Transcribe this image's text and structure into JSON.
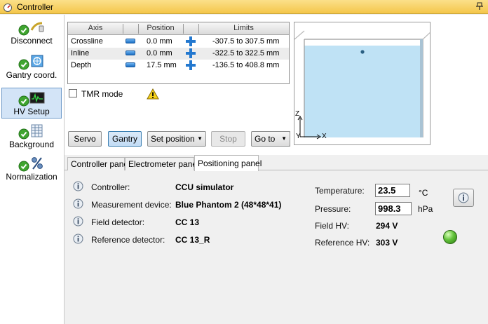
{
  "window": {
    "title": "Controller"
  },
  "sidebar": {
    "items": [
      {
        "label": "Disconnect",
        "icon": "disconnect-plug-icon"
      },
      {
        "label": "Gantry coord.",
        "icon": "gantry-coordinates-icon"
      },
      {
        "label": "HV Setup",
        "icon": "hv-oscilloscope-icon",
        "active": true
      },
      {
        "label": "Background",
        "icon": "background-grid-icon"
      },
      {
        "label": "Normalization",
        "icon": "percent-icon"
      }
    ]
  },
  "axis_table": {
    "headers": [
      "Axis",
      "Position",
      "Limits"
    ],
    "rows": [
      {
        "axis": "Crossline",
        "position": "0.0 mm",
        "limits": "-307.5 to 307.5 mm"
      },
      {
        "axis": "Inline",
        "position": "0.0 mm",
        "limits": "-322.5 to 322.5 mm"
      },
      {
        "axis": "Depth",
        "position": "17.5 mm",
        "limits": "-136.5 to 408.8 mm"
      }
    ]
  },
  "tmr": {
    "label": "TMR mode",
    "checked": false
  },
  "buttons": {
    "servo": "Servo",
    "gantry": "Gantry",
    "set_position": "Set position",
    "stop": "Stop",
    "go_to": "Go to"
  },
  "phantom_view": {
    "axes": {
      "z": "Z",
      "y": "Y",
      "x": "X"
    },
    "water_color": "#bfe2f5"
  },
  "tabs": [
    {
      "label": "Controller panel",
      "active": false
    },
    {
      "label": "Electrometer panel",
      "active": false
    },
    {
      "label": "Positioning panel",
      "active": true
    }
  ],
  "panel": {
    "info": [
      {
        "label": "Controller:",
        "value": "CCU simulator"
      },
      {
        "label": "Measurement device:",
        "value": "Blue Phantom 2  (48*48*41)"
      },
      {
        "label": "Field detector:",
        "value": "CC 13"
      },
      {
        "label": "Reference detector:",
        "value": "CC 13_R"
      }
    ],
    "temperature": {
      "label": "Temperature:",
      "value": "23.5",
      "unit": "°C"
    },
    "pressure": {
      "label": "Pressure:",
      "value": "998.3",
      "unit": "hPa"
    },
    "field_hv": {
      "label": "Field HV:",
      "value": "294 V"
    },
    "reference_hv": {
      "label": "Reference HV:",
      "value": "303 V"
    },
    "status_led_color": "#4fb52c"
  }
}
